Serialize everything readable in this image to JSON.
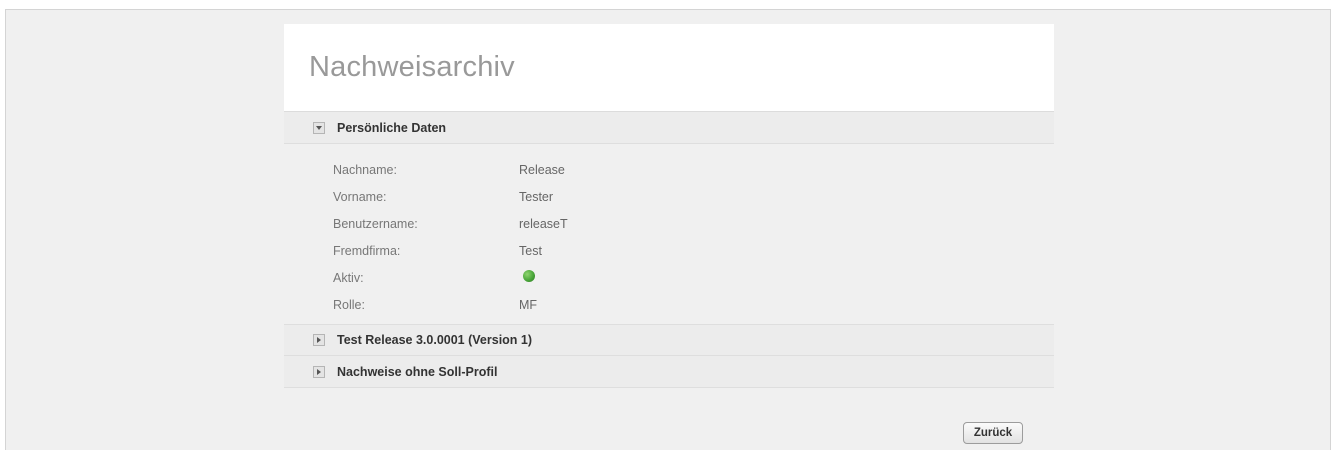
{
  "page": {
    "title": "Nachweisarchiv"
  },
  "sections": {
    "personal": {
      "title": "Persönliche Daten",
      "expanded": true,
      "fields": {
        "nachname": {
          "label": "Nachname:",
          "value": "Release"
        },
        "vorname": {
          "label": "Vorname:",
          "value": "Tester"
        },
        "benutzername": {
          "label": "Benutzername:",
          "value": "releaseT"
        },
        "fremdfirma": {
          "label": "Fremdfirma:",
          "value": "Test"
        },
        "aktiv": {
          "label": "Aktiv:",
          "status": "active",
          "status_color": "#4aa63a"
        },
        "rolle": {
          "label": "Rolle:",
          "value": "MF"
        }
      }
    },
    "release": {
      "title": "Test Release 3.0.0001 (Version 1)",
      "expanded": false
    },
    "nachweise": {
      "title": "Nachweise ohne Soll-Profil",
      "expanded": false
    }
  },
  "buttons": {
    "back_label": "Zurück"
  }
}
